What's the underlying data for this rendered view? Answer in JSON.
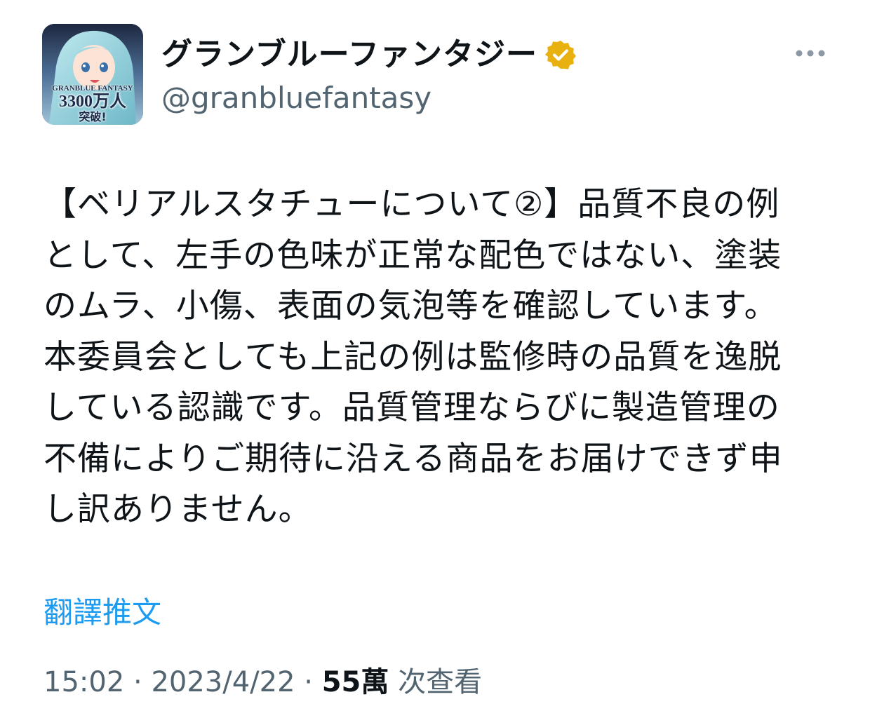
{
  "account": {
    "display_name": "グランブルーファンタジー",
    "handle": "@granbluefantasy",
    "verified_icon": "verified-badge-gold-icon",
    "avatar_text": {
      "line1": "GRANBLUE FANTASY",
      "line2": "3300万人",
      "line3": "突破!"
    }
  },
  "more_icon": "more-horizontal-icon",
  "tweet": {
    "text": "【ベリアルスタチューについて②】品質不良の例として、左手の色味が正常な配色ではない、塗装のムラ、小傷、表面の気泡等を確認しています。本委員会としても上記の例は監修時の品質を逸脱している認識です。品質管理ならびに製造管理の不備によりご期待に沿える商品をお届けできず申し訳ありません。",
    "translate_label": "翻譯推文"
  },
  "meta": {
    "time": "15:02",
    "separator": " · ",
    "date": "2023/4/22",
    "views_count": "55萬",
    "views_label": " 次查看"
  },
  "colors": {
    "link": "#1d9bf0",
    "secondary": "#536471",
    "badge": "#e8b10f",
    "text": "#0f1419"
  }
}
